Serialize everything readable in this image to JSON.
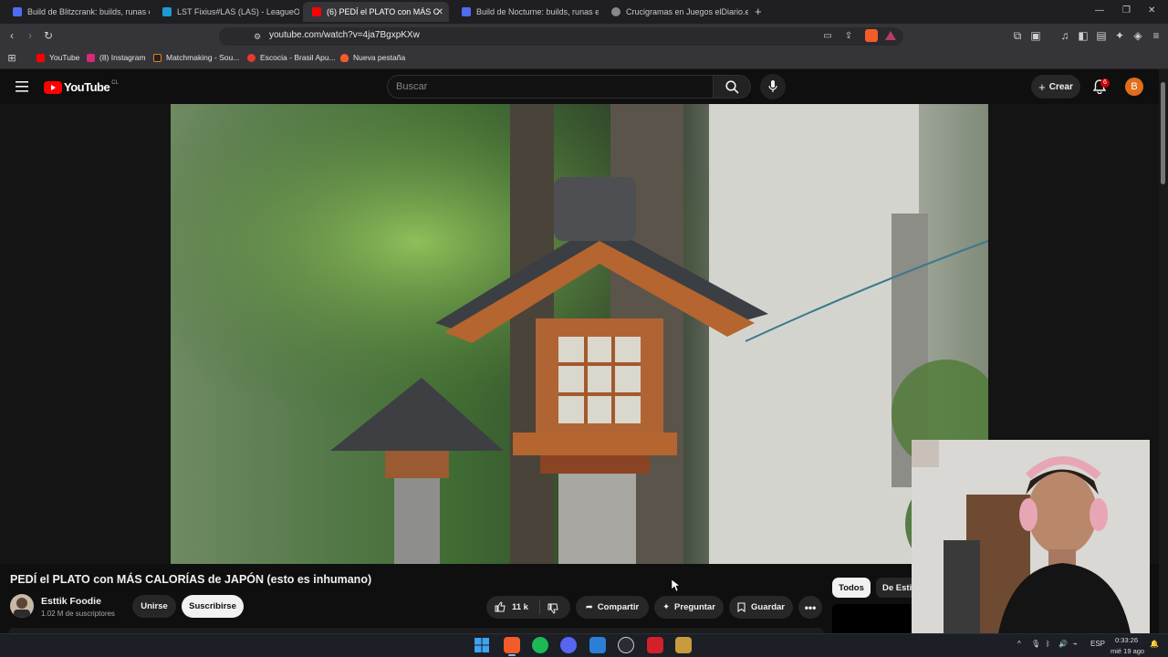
{
  "browser": {
    "tabs": [
      {
        "label": "Build de Blitzcrank: builds, runas e ob",
        "active": false,
        "color": "#4f6cf0"
      },
      {
        "label": "LST Fixius#LAS (LAS) - LeagueOfGrap",
        "active": false,
        "color": "#1c9bd6"
      },
      {
        "label": "(6) PEDÍ el PLATO con MÁS C",
        "active": true,
        "color": "#ff0000"
      },
      {
        "label": "Build de Nocturne: builds, runas e ob",
        "active": false,
        "color": "#4f6cf0"
      },
      {
        "label": "Crucigramas en Juegos elDiario.es",
        "active": false,
        "color": "#888888"
      }
    ],
    "new_tab_label": "+",
    "url": "youtube.com/watch?v=4ja7BgxpKXw",
    "bookmarks": [
      {
        "label": "YouTube",
        "color": "#ff0000"
      },
      {
        "label": "(8) Instagram",
        "color": "#d62976"
      },
      {
        "label": "Matchmaking - Sou...",
        "color": "#f07a1a"
      },
      {
        "label": "Escocia - Brasil Apu...",
        "color": "#e53b2a"
      },
      {
        "label": "Nueva pestaña",
        "color": "#f25c2a"
      }
    ]
  },
  "youtube": {
    "logo_text": "YouTube",
    "logo_region": "CL",
    "search_placeholder": "Buscar",
    "create_label": "Crear",
    "notifications_count": "6",
    "avatar_letter": "B"
  },
  "video": {
    "title": "PEDÍ el PLATO con MÁS CALORÍAS de JAPÓN (esto es inhumano)",
    "channel_name": "Esttik Foodie",
    "subscribers": "1.02 M de suscriptores",
    "join_label": "Unirse",
    "subscribe_label": "Suscribirse",
    "like_count": "11 k",
    "share_label": "Compartir",
    "ask_label": "Preguntar",
    "save_label": "Guardar"
  },
  "chips": {
    "all_label": "Todos",
    "second_label": "De Esti"
  },
  "taskbar": {
    "lang": "ESP",
    "time": "0:33:26",
    "date": "mié 19 ago"
  }
}
